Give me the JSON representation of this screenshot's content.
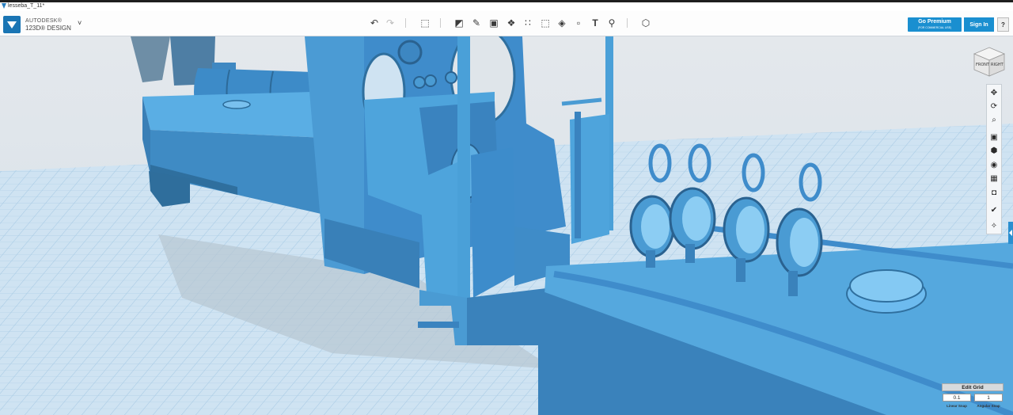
{
  "window": {
    "title": "lesseba_T_11*"
  },
  "app": {
    "vendor": "AUTODESK®",
    "product": "123D® DESIGN",
    "menu_caret": "˅"
  },
  "toolbar": {
    "undo_icon": "↶",
    "redo_icon": "↷",
    "tools": [
      {
        "name": "transform-icon",
        "glyph": "⬚"
      },
      {
        "name": "primitives-icon",
        "glyph": "◩"
      },
      {
        "name": "sketch-icon",
        "glyph": "✎"
      },
      {
        "name": "construct-icon",
        "glyph": "▣"
      },
      {
        "name": "modify-icon",
        "glyph": "❖"
      },
      {
        "name": "pattern-icon",
        "glyph": "∷"
      },
      {
        "name": "group-icon",
        "glyph": "⬚"
      },
      {
        "name": "combine-icon",
        "glyph": "◈"
      },
      {
        "name": "measure-icon",
        "glyph": "▫"
      },
      {
        "name": "text-icon",
        "glyph": "T"
      },
      {
        "name": "snap-icon",
        "glyph": "⚲"
      },
      {
        "name": "material-icon",
        "glyph": "⬡"
      }
    ],
    "premium_label": "Go Premium",
    "premium_sub": "(FOR COMMERCIAL USE)",
    "signin_label": "Sign In",
    "help_label": "?"
  },
  "viewcube": {
    "left": "FRONT",
    "right": "RIGHT"
  },
  "nav": [
    {
      "name": "pan-icon",
      "glyph": "✥"
    },
    {
      "name": "orbit-icon",
      "glyph": "⟳"
    },
    {
      "name": "zoom-icon",
      "glyph": "⌕"
    },
    {
      "name": "fit-icon",
      "glyph": "▣"
    },
    {
      "name": "view-cube-icon",
      "glyph": "⬢"
    },
    {
      "name": "visibility-icon",
      "glyph": "◉"
    },
    {
      "name": "material-view-icon",
      "glyph": "▦"
    },
    {
      "name": "camera-icon",
      "glyph": "◘"
    },
    {
      "name": "snap-nav-icon",
      "glyph": "✔"
    },
    {
      "name": "grid-snap-icon",
      "glyph": "✧"
    }
  ],
  "grid": {
    "edit_label": "Edit Grid",
    "linear_snap_value": "0.1",
    "angular_snap_value": "1",
    "linear_snap_label": "Linear Snap",
    "angular_snap_label": "Angular Snap"
  },
  "colors": {
    "model": "#4b9bd4",
    "model_dark": "#2f6f9e",
    "accent": "#1a8fd0"
  }
}
